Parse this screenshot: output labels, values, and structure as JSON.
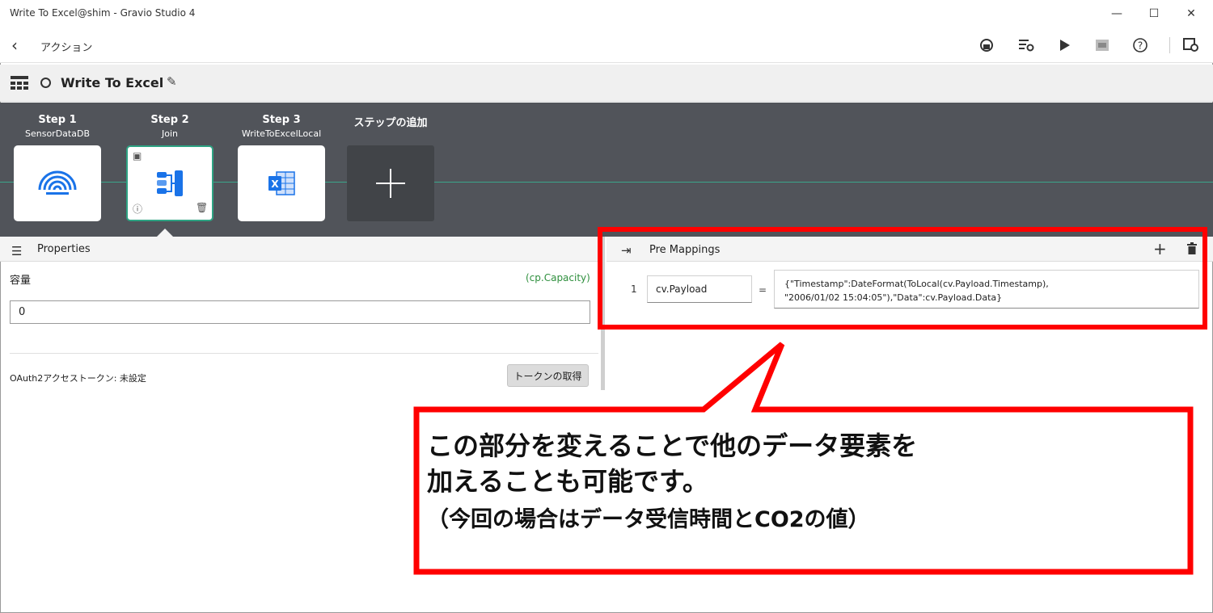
{
  "window": {
    "title": "Write To Excel@shim - Gravio Studio 4",
    "minimize": "—",
    "maximize": "☐",
    "close": "✕"
  },
  "toolbar": {
    "back": "‹",
    "title": "アクション"
  },
  "action": {
    "title": "Write To Excel"
  },
  "steps": [
    {
      "name": "Step 1",
      "sub": "SensorDataDB"
    },
    {
      "name": "Step 2",
      "sub": "Join"
    },
    {
      "name": "Step 3",
      "sub": "WriteToExcelLocal"
    },
    {
      "name": "ステップの追加",
      "sub": ""
    }
  ],
  "properties": {
    "header": "Properties",
    "capacity_label": "容量",
    "capacity_var": "(cp.Capacity)",
    "capacity_value": "0",
    "oauth_label": "OAuth2アクセストークン:  未設定",
    "token_button": "トークンの取得"
  },
  "pre_mappings": {
    "header": "Pre Mappings",
    "add": "+",
    "row_number": "1",
    "key": "cv.Payload",
    "equals": "=",
    "value_line1": "{\"Timestamp\":DateFormat(ToLocal(cv.Payload.Timestamp),",
    "value_line2": "\"2006/01/02 15:04:05\"),\"Data\":cv.Payload.Data}"
  },
  "callout": {
    "line1": "この部分を変えることで他のデータ要素を",
    "line2": "加えることも可能です。",
    "line3": "（今回の場合はデータ受信時間とCO2の値）"
  },
  "colors": {
    "accent_red": "#ff0000",
    "step_panel": "#51545a",
    "icon_blue": "#1a73e8",
    "selected_teal": "#2ea383",
    "variable_green": "#2e8f3d"
  }
}
